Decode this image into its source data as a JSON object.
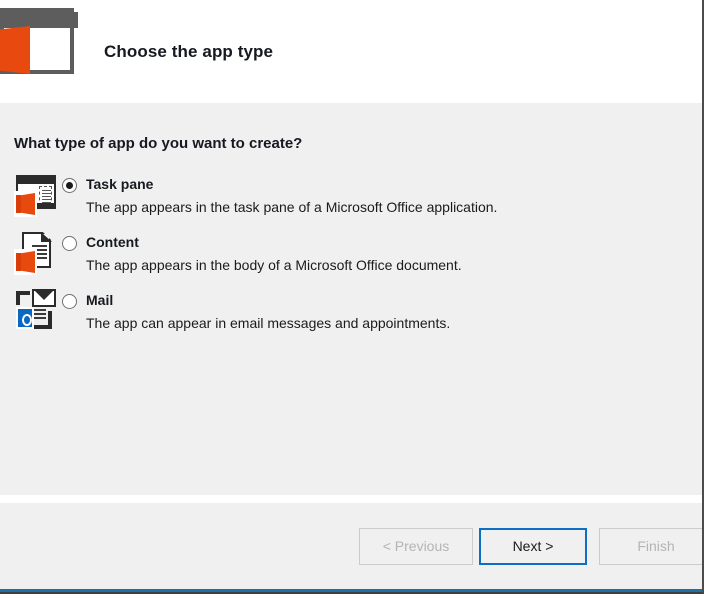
{
  "window": {
    "header": {
      "title": "Choose the app type",
      "logo_icon": "office-app-window-icon"
    },
    "body": {
      "question": "What type of app do you want to create?",
      "options": [
        {
          "id": "task-pane",
          "label": "Task pane",
          "description": "The app appears in the task pane of a Microsoft Office application.",
          "selected": true,
          "icon": "task-pane-icon"
        },
        {
          "id": "content",
          "label": "Content",
          "description": "The app appears in the body of a Microsoft Office document.",
          "selected": false,
          "icon": "content-document-icon"
        },
        {
          "id": "mail",
          "label": "Mail",
          "description": "The app can appear in email messages and appointments.",
          "selected": false,
          "icon": "mail-envelope-icon"
        }
      ]
    },
    "footer": {
      "buttons": [
        {
          "id": "previous",
          "label": "< Previous",
          "enabled": false
        },
        {
          "id": "next",
          "label": "Next >",
          "enabled": true,
          "is_default": true
        },
        {
          "id": "finish",
          "label": "Finish",
          "enabled": false
        }
      ]
    }
  },
  "colors": {
    "office_orange": "#e8490f",
    "outlook_blue": "#0a67c2",
    "focus_blue": "#0d6fc4",
    "body_background": "#f0f0f0",
    "header_background": "#ffffff",
    "disabled_text": "#b4b4b4"
  }
}
